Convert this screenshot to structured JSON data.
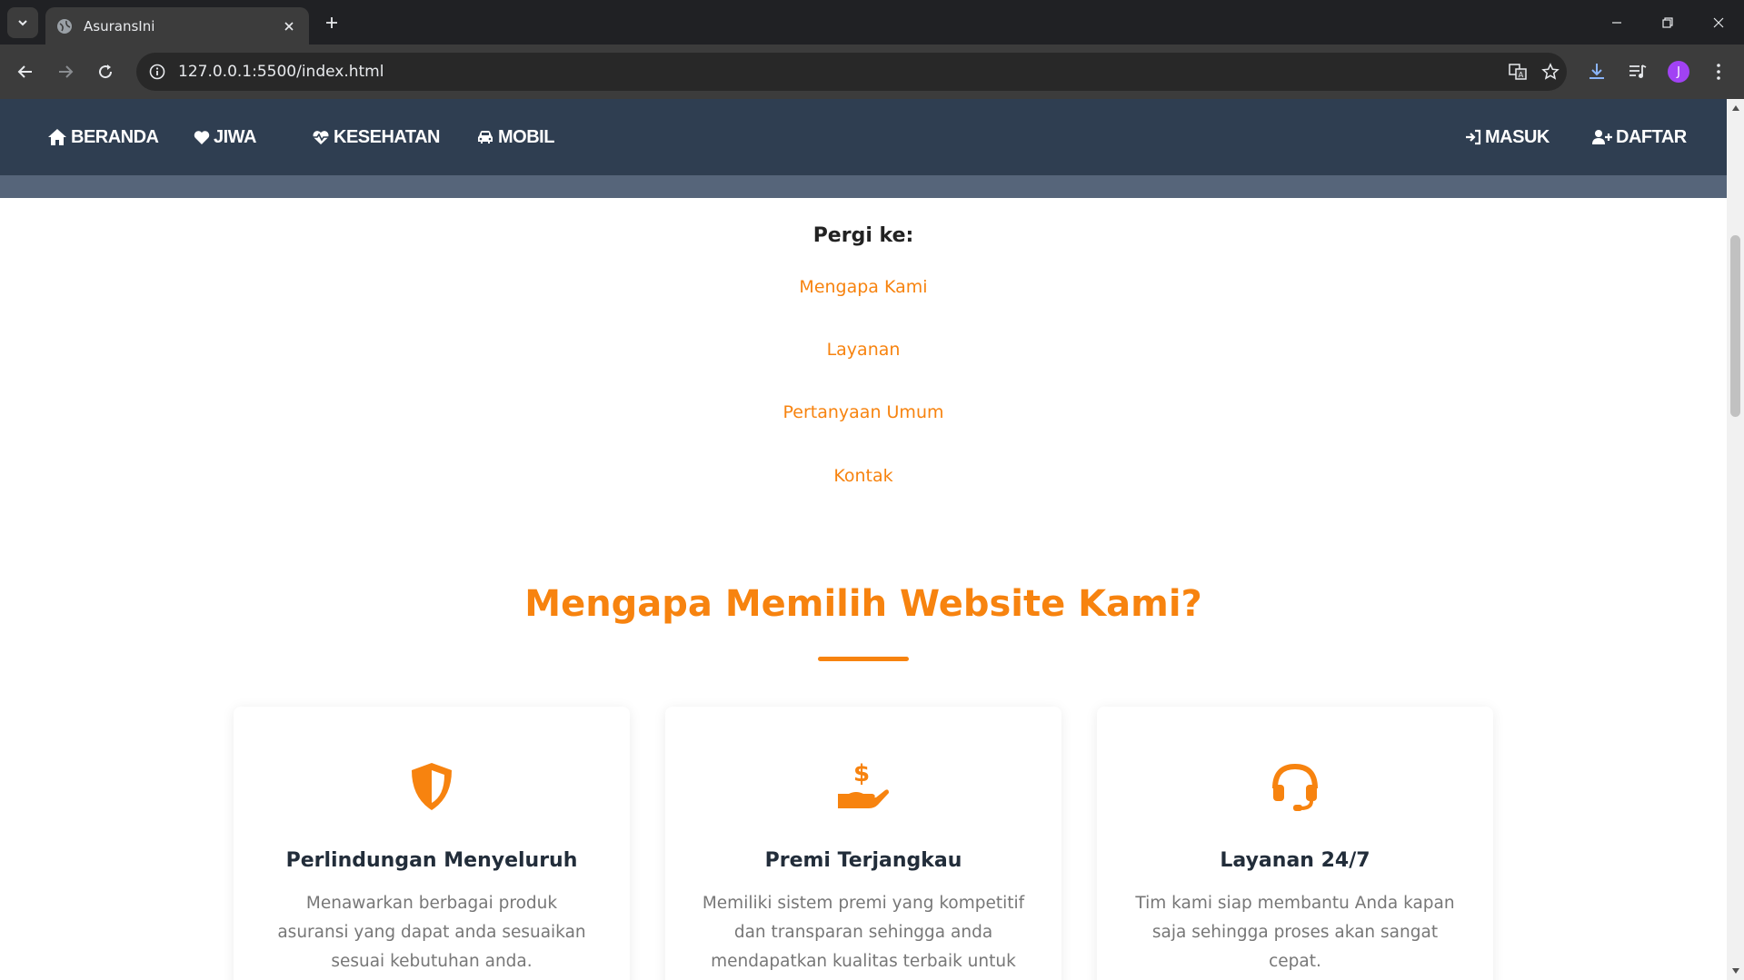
{
  "browser": {
    "tab_title": "AsuransIni",
    "url": "127.0.0.1:5500/index.html",
    "avatar_letter": "J"
  },
  "nav": {
    "left": [
      "BERANDA",
      "JIWA",
      "KESEHATAN",
      "MOBIL"
    ],
    "right": [
      "MASUK",
      "DAFTAR"
    ]
  },
  "goto": {
    "title": "Pergi ke:",
    "links": [
      "Mengapa Kami",
      "Layanan",
      "Pertanyaan Umum",
      "Kontak"
    ]
  },
  "why": {
    "title": "Mengapa Memilih Website Kami?",
    "cards": [
      {
        "icon": "shield-icon",
        "title": "Perlindungan Menyeluruh",
        "desc": "Menawarkan berbagai produk asuransi yang dapat anda sesuaikan sesuai kebutuhan anda."
      },
      {
        "icon": "hand-dollar-icon",
        "title": "Premi Terjangkau",
        "desc": "Memiliki sistem premi yang kompetitif dan transparan sehingga anda mendapatkan kualitas terbaik untuk"
      },
      {
        "icon": "headset-icon",
        "title": "Layanan 24/7",
        "desc": "Tim kami siap membantu Anda kapan saja sehingga proses akan sangat cepat."
      }
    ]
  },
  "colors": {
    "accent": "#f7830f",
    "navbar": "#2f3e51"
  }
}
